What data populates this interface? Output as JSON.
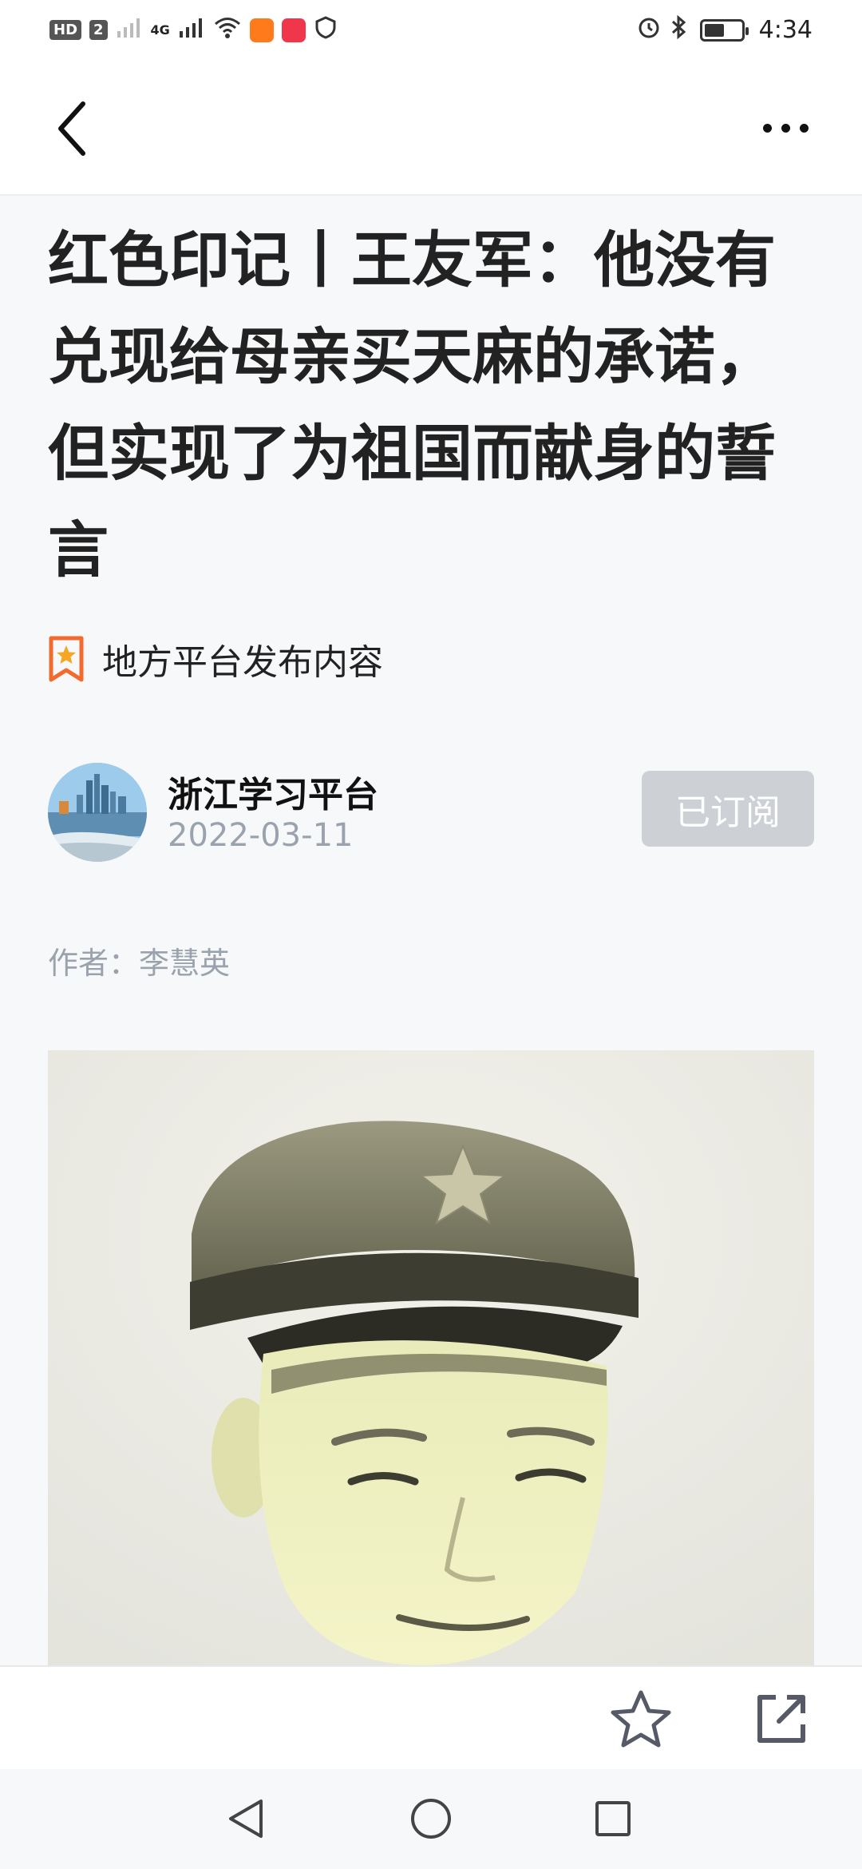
{
  "status_bar": {
    "left_badges": [
      "HD",
      "2"
    ],
    "network_label": "4G",
    "time": "4:34",
    "battery_level": 0.55,
    "icons": [
      "sim-signal-icon",
      "signal-icon",
      "wifi-icon",
      "app-notification-icon",
      "app-notification-icon",
      "shield-icon",
      "alarm-icon",
      "bluetooth-icon",
      "battery-icon"
    ]
  },
  "nav": {
    "back_icon": "chevron-left-icon",
    "more_icon": "more-dots-icon"
  },
  "article": {
    "title": "红色印记丨王友军：他没有兑现给母亲买天麻的承诺，但实现了为祖国而献身的誓言",
    "source_tag": "地方平台发布内容",
    "publisher": {
      "name": "浙江学习平台",
      "date": "2022-03-11",
      "subscribe_label": "已订阅"
    },
    "author_line": "作者：李慧英"
  },
  "toolbar": {
    "favorite_icon": "star-icon",
    "share_icon": "share-icon"
  },
  "system_nav": {
    "icons": [
      "back-triangle-icon",
      "home-circle-icon",
      "recents-square-icon"
    ]
  },
  "colors": {
    "background": "#f7f8fa",
    "subscribed_button": "#cdd1d6",
    "tag_orange": "#f26a2e",
    "tag_star": "#f5a623",
    "muted_text": "#9aa3ad"
  }
}
